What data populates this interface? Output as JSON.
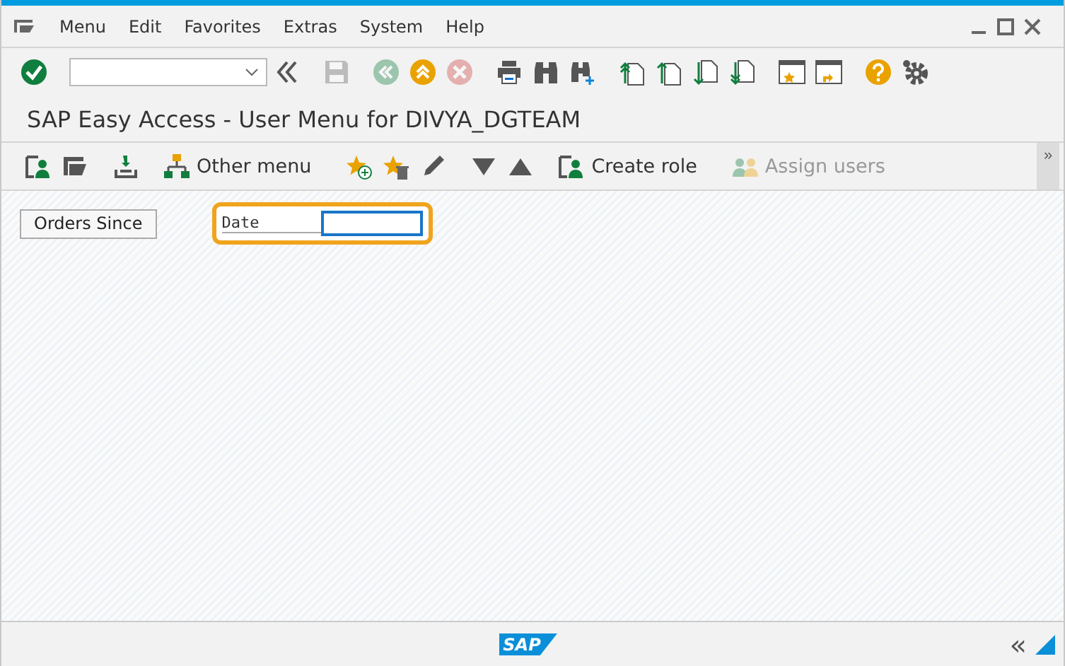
{
  "menu_bar": {
    "items": [
      {
        "label": "Menu"
      },
      {
        "label": "Edit"
      },
      {
        "label": "Favorites"
      },
      {
        "label": "Extras"
      },
      {
        "label": "System"
      },
      {
        "label": "Help"
      }
    ]
  },
  "system_toolbar": {
    "items": [
      {
        "kind": "enter",
        "disabled": false
      },
      {
        "kind": "command"
      },
      {
        "kind": "collapse",
        "disabled": false
      },
      {
        "kind": "save",
        "disabled": true
      },
      {
        "kind": "back",
        "disabled": true
      },
      {
        "kind": "exit",
        "disabled": false
      },
      {
        "kind": "cancel",
        "disabled": true
      },
      {
        "kind": "print",
        "disabled": false
      },
      {
        "kind": "find",
        "disabled": false
      },
      {
        "kind": "find-next",
        "disabled": false
      },
      {
        "kind": "first-page",
        "disabled": false
      },
      {
        "kind": "prev-page",
        "disabled": false
      },
      {
        "kind": "next-page",
        "disabled": false
      },
      {
        "kind": "last-page",
        "disabled": false
      },
      {
        "kind": "new-session",
        "disabled": false
      },
      {
        "kind": "shortcut",
        "disabled": false
      },
      {
        "kind": "help",
        "disabled": false
      },
      {
        "kind": "settings",
        "disabled": false
      }
    ]
  },
  "title": "SAP Easy Access  -  User Menu for DIVYA_DGTEAM",
  "app_toolbar": {
    "items": [
      {
        "kind": "user-menu",
        "disabled": false
      },
      {
        "kind": "sap-menu",
        "disabled": false
      },
      {
        "kind": "business-workplace",
        "disabled": false
      },
      {
        "kind": "other-menu",
        "label": "Other menu",
        "disabled": false
      },
      {
        "kind": "add-favorite",
        "disabled": false
      },
      {
        "kind": "delete-favorite",
        "disabled": false
      },
      {
        "kind": "change-favorite",
        "disabled": false
      },
      {
        "kind": "move-down",
        "disabled": false
      },
      {
        "kind": "move-up",
        "disabled": false
      },
      {
        "kind": "create-role",
        "label": "Create role",
        "disabled": false
      },
      {
        "kind": "assign-users",
        "label": "Assign users",
        "disabled": true
      }
    ],
    "overflow": "»"
  },
  "content": {
    "button": "Orders Since",
    "field": {
      "label": "Date",
      "focused": true
    }
  },
  "status_bar": {
    "logo_text": "SAP",
    "toggle": "«"
  }
}
